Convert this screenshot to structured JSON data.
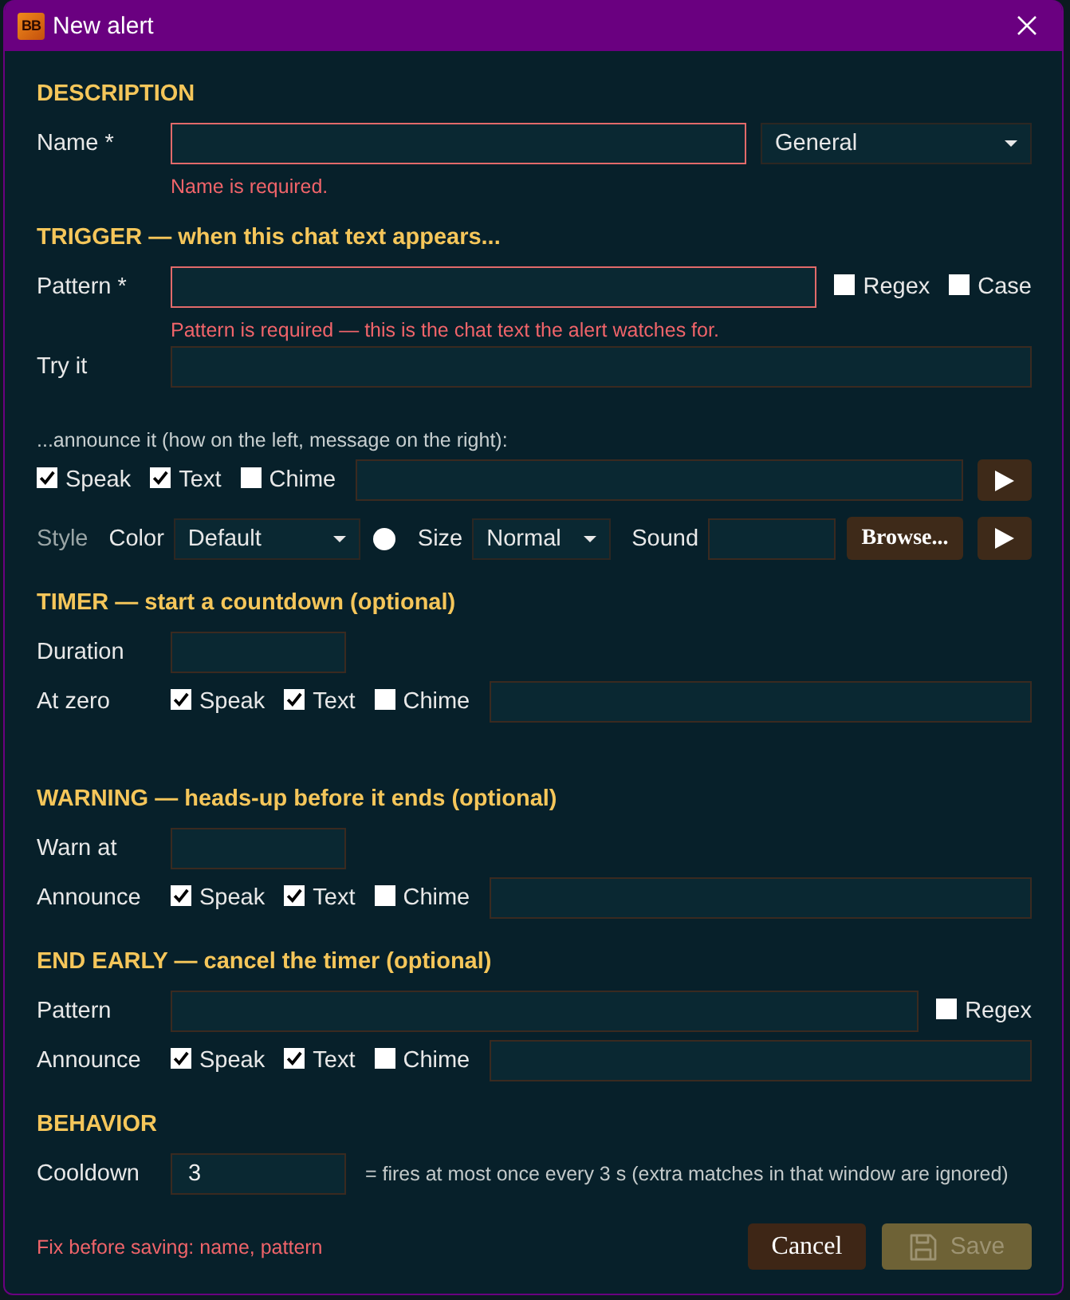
{
  "window": {
    "title": "New alert",
    "logo": "BB"
  },
  "sections": [
    {
      "heading": "DESCRIPTION",
      "rows": [
        {
          "kind": "field",
          "label": "Name *",
          "invalid": true,
          "dropdown": {
            "value": "General"
          },
          "error": "Name is required."
        }
      ]
    },
    {
      "heading": "TRIGGER — when this chat text appears...",
      "rows": [
        {
          "kind": "field",
          "label": "Pattern *",
          "invalid": true,
          "options": [
            {
              "label": "Regex",
              "checked": false
            },
            {
              "label": "Case",
              "checked": false
            }
          ],
          "error": "Pattern is required — this is the chat text the alert watches for."
        },
        {
          "kind": "field",
          "label": "Try it",
          "invalid": false
        },
        {
          "kind": "caption",
          "text": "...announce it (how on the left, message on the right):"
        },
        {
          "kind": "announce",
          "options": [
            {
              "label": "Speak",
              "checked": true
            },
            {
              "label": "Text",
              "checked": true
            },
            {
              "label": "Chime",
              "checked": false
            }
          ],
          "play_button": true
        },
        {
          "kind": "style",
          "label": "Style",
          "color_picker": {
            "label": "Color",
            "value": "Default",
            "color": "#ffffff"
          },
          "size": {
            "label": "Size",
            "value": "Normal"
          },
          "sound": {
            "label": "Sound",
            "button": "Browse...",
            "play_button": true
          }
        }
      ]
    },
    {
      "heading": "TIMER — start a countdown (optional)",
      "rows": [
        {
          "kind": "number",
          "label": "Duration",
          "invalid": false
        },
        {
          "kind": "announce",
          "label": "At zero",
          "options": [
            {
              "label": "Speak",
              "checked": true
            },
            {
              "label": "Text",
              "checked": true
            },
            {
              "label": "Chime",
              "checked": false
            }
          ]
        }
      ]
    },
    {
      "heading": "WARNING — heads-up before it ends (optional)",
      "rows": [
        {
          "kind": "number",
          "label": "Warn at",
          "invalid": false
        },
        {
          "kind": "announce",
          "label": "Announce",
          "options": [
            {
              "label": "Speak",
              "checked": true
            },
            {
              "label": "Text",
              "checked": true
            },
            {
              "label": "Chime",
              "checked": false
            }
          ]
        }
      ]
    },
    {
      "heading": "END EARLY — cancel the timer (optional)",
      "rows": [
        {
          "kind": "field",
          "label": "Pattern",
          "invalid": false,
          "options": [
            {
              "label": "Regex",
              "checked": false
            }
          ]
        },
        {
          "kind": "announce",
          "label": "Announce",
          "options": [
            {
              "label": "Speak",
              "checked": true
            },
            {
              "label": "Text",
              "checked": true
            },
            {
              "label": "Chime",
              "checked": false
            }
          ]
        }
      ]
    },
    {
      "heading": "BEHAVIOR",
      "rows": [
        {
          "kind": "number",
          "label": "Cooldown",
          "invalid": false,
          "value": "3",
          "hint": "= fires at most once every 3 s (extra matches in that window are ignored)"
        }
      ]
    }
  ],
  "footer": {
    "error": "Fix before saving: name, pattern",
    "buttons": [
      {
        "kind": "cancel",
        "label": "Cancel",
        "disabled": false
      },
      {
        "kind": "save",
        "label": "Save",
        "disabled": true
      }
    ]
  }
}
